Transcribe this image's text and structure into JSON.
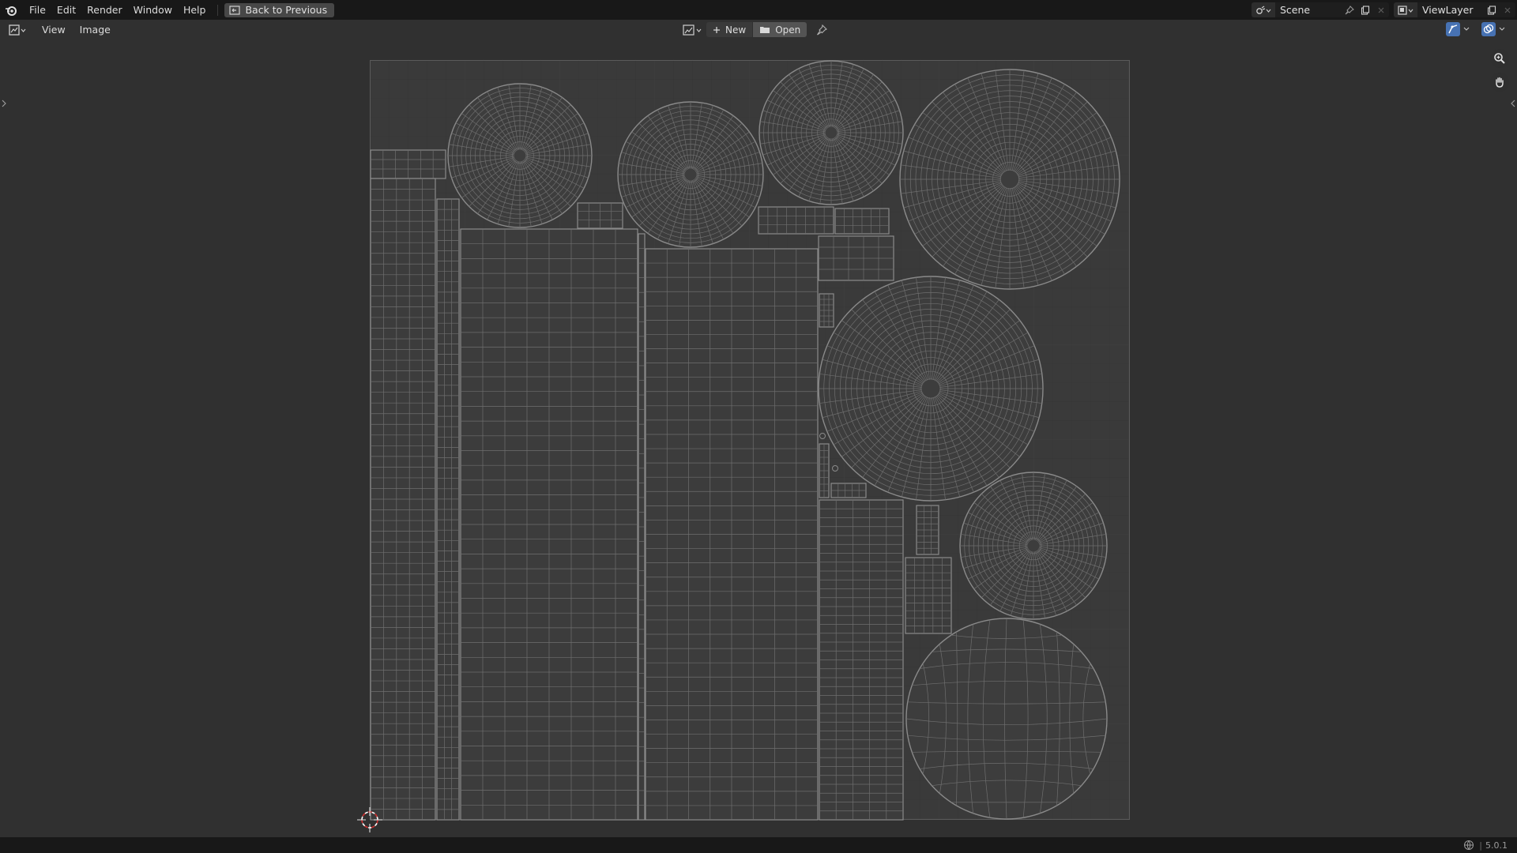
{
  "topbar": {
    "menus": [
      "File",
      "Edit",
      "Render",
      "Window",
      "Help"
    ],
    "back_button": "Back to Previous",
    "scene": "Scene",
    "view_layer": "ViewLayer"
  },
  "header": {
    "menus": [
      "View",
      "Image"
    ],
    "new_label": "New",
    "open_label": "Open"
  },
  "status": {
    "version": "5.0.1"
  },
  "colors": {
    "topbar": "#181818",
    "editor_bg": "#303030",
    "uv_canvas": "#3a3a3a",
    "wire": "#8c8c8c",
    "cursor_red": "#d03030",
    "accent_blue": "#4772b3"
  },
  "icons": [
    "blender-logo-icon",
    "back-icon",
    "scene-icon",
    "pin-icon",
    "new-scene-icon",
    "close-icon",
    "view-layer-icon",
    "image-editor-icon",
    "image-browse-icon",
    "new-icon",
    "open-folder-icon",
    "uv-sync-icon",
    "overlay-icon",
    "zoom-icon",
    "hand-icon",
    "world-icon",
    "cursor-icon"
  ]
}
